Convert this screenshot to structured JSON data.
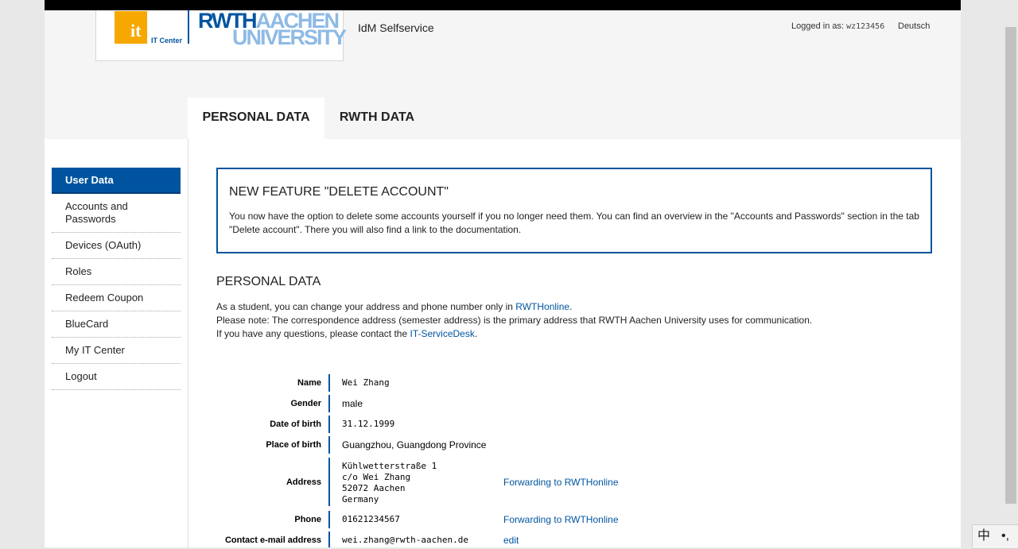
{
  "header": {
    "logo": {
      "it_mark": "it",
      "it_center": "IT Center",
      "rwth": "RWTH",
      "aachen": "AACHEN",
      "university": "UNIVERSITY"
    },
    "app_title": "IdM Selfservice",
    "logged_in_label": "Logged in as:",
    "logged_in_user": "wz123456",
    "language": "Deutsch"
  },
  "tabs": [
    {
      "label": "PERSONAL DATA",
      "active": true
    },
    {
      "label": "RWTH DATA",
      "active": false
    }
  ],
  "sidebar": {
    "items": [
      {
        "label": "User Data",
        "active": true
      },
      {
        "label": "Accounts and Passwords"
      },
      {
        "label": "Devices (OAuth)"
      },
      {
        "label": "Roles"
      },
      {
        "label": "Redeem Coupon"
      },
      {
        "label": "BlueCard"
      },
      {
        "label": "My IT Center"
      },
      {
        "label": "Logout"
      }
    ]
  },
  "notice": {
    "title": "NEW FEATURE \"DELETE ACCOUNT\"",
    "text": "You now have the option to delete some accounts yourself if you no longer need them. You can find an overview in the \"Accounts and Passwords\" section in the tab \"Delete account\". There you will also find a link to the documentation."
  },
  "personal": {
    "title": "PERSONAL DATA",
    "intro1_prefix": "As a student, you can change your address and phone number only in ",
    "intro1_link": "RWTHonline",
    "intro1_suffix": ".",
    "intro2": "Please note: The correspondence address (semester address) is the primary address that RWTH Aachen University uses for communication.",
    "intro3_prefix": "If you have any questions, please contact the ",
    "intro3_link": "IT-ServiceDesk",
    "intro3_suffix": "."
  },
  "fields": {
    "name": {
      "label": "Name",
      "value": "Wei Zhang"
    },
    "gender": {
      "label": "Gender",
      "value": "male"
    },
    "dob": {
      "label": "Date of birth",
      "value": "31.12.1999"
    },
    "pob": {
      "label": "Place of birth",
      "value": "Guangzhou, Guangdong Province"
    },
    "address": {
      "label": "Address",
      "line1": "Kühlwetterstraße 1",
      "line2": "c/o Wei Zhang",
      "line3": "52072 Aachen",
      "line4": "Germany",
      "action": "Forwarding to RWTHonline"
    },
    "phone": {
      "label": "Phone",
      "value": "01621234567",
      "action": "Forwarding to RWTHonline"
    },
    "email": {
      "label": "Contact e-mail address",
      "value": "wei.zhang@rwth-aachen.de",
      "action": "edit"
    }
  },
  "ime": {
    "char1": "中",
    "char2": "•,"
  }
}
